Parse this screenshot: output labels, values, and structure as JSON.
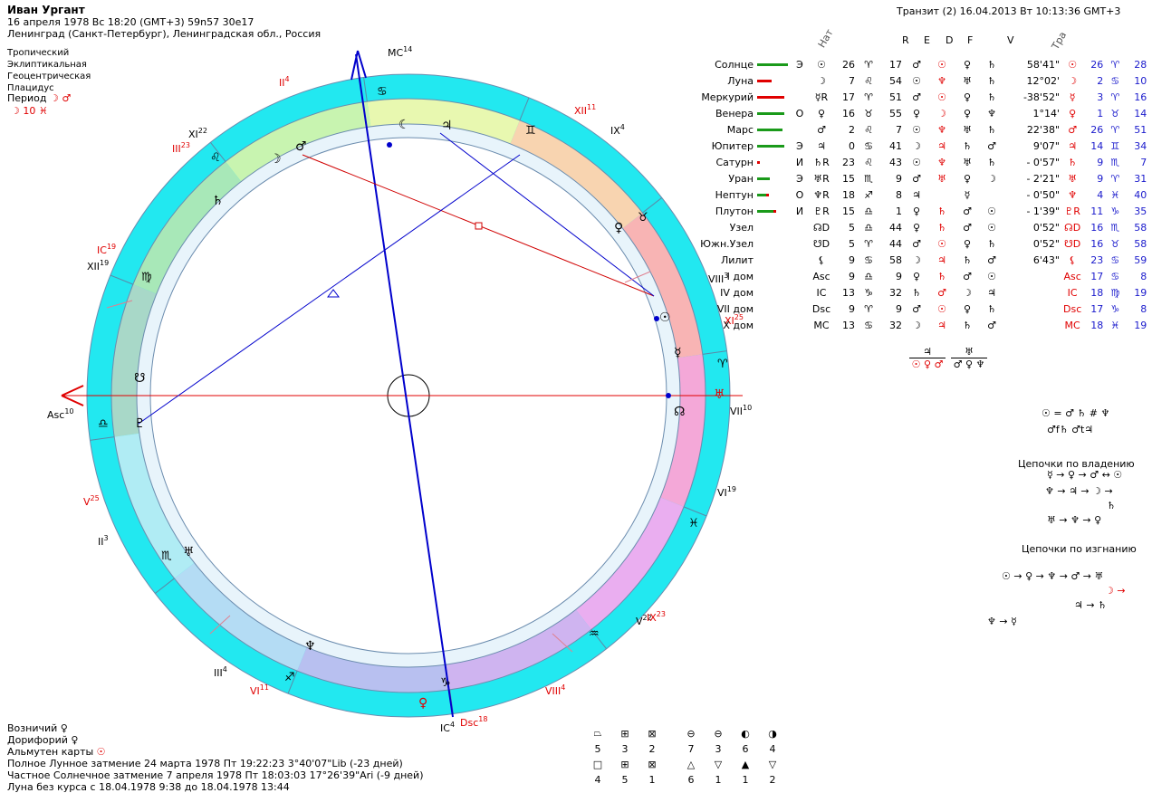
{
  "header": {
    "name": "Иван Ургант",
    "line1": "16 апреля 1978  Вс  18:20 (GMT+3) 59n57  30e17",
    "line2": "Ленинград (Санкт-Петербург), Ленинградская обл., Россия",
    "opts": [
      "Тропический",
      "Эклиптикальная",
      "Геоцентрическая",
      "Плацидус"
    ],
    "period_label": "Период",
    "period_syms": "☽ ♂",
    "period2": "☽   10 ♓"
  },
  "transit": "Транзит (2) 16.04.2013  Вт 10:13:36 GMT+3",
  "col_headers": {
    "nat": "Нат",
    "r": "R",
    "e": "E",
    "d": "D",
    "f": "F",
    "v": "V",
    "tra": "Тра"
  },
  "planets": [
    {
      "name": "Солнце",
      "cls": "Э",
      "sym": "☉",
      "deg": "26",
      "sign": "♈",
      "min": "17",
      "r": "♂",
      "e": "☉",
      "d": "♀",
      "f": "♄",
      "v": "58'41\"",
      "tsym": "☉",
      "tdeg": "26",
      "tsign": "♈",
      "tmin": "28",
      "bg": 34,
      "br": 0
    },
    {
      "name": "Луна",
      "cls": "",
      "sym": "☽",
      "deg": "7",
      "sign": "♌",
      "min": "54",
      "r": "☉",
      "e": "♆",
      "d": "♅",
      "f": "♄",
      "v": "12°02'",
      "tsym": "☽",
      "tdeg": "2",
      "tsign": "♋",
      "tmin": "10",
      "bg": 0,
      "br": 16
    },
    {
      "name": "Меркурий",
      "cls": "",
      "sym": "☿R",
      "deg": "17",
      "sign": "♈",
      "min": "51",
      "r": "♂",
      "e": "☉",
      "d": "♀",
      "f": "♄",
      "v": "-38'52\"",
      "tsym": "☿",
      "tdeg": "3",
      "tsign": "♈",
      "tmin": "16",
      "bg": 0,
      "br": 30
    },
    {
      "name": "Венера",
      "cls": "О",
      "sym": "♀",
      "deg": "16",
      "sign": "♉",
      "min": "55",
      "r": "♀",
      "e": "☽",
      "d": "♀",
      "f": "♆",
      "v": "1°14'",
      "tsym": "♀",
      "tdeg": "1",
      "tsign": "♉",
      "tmin": "14",
      "bg": 30,
      "br": 0
    },
    {
      "name": "Марс",
      "cls": "",
      "sym": "♂",
      "deg": "2",
      "sign": "♌",
      "min": "7",
      "r": "☉",
      "e": "♆",
      "d": "♅",
      "f": "♄",
      "v": "22'38\"",
      "tsym": "♂",
      "tdeg": "26",
      "tsign": "♈",
      "tmin": "51",
      "bg": 28,
      "br": 0
    },
    {
      "name": "Юпитер",
      "cls": "Э",
      "sym": "♃",
      "deg": "0",
      "sign": "♋",
      "min": "41",
      "r": "☽",
      "e": "♃",
      "d": "♄",
      "f": "♂",
      "v": "9'07\"",
      "tsym": "♃",
      "tdeg": "14",
      "tsign": "♊",
      "tmin": "34",
      "bg": 30,
      "br": 0
    },
    {
      "name": "Сатурн",
      "cls": "И",
      "sym": "♄R",
      "deg": "23",
      "sign": "♌",
      "min": "43",
      "r": "☉",
      "e": "♆",
      "d": "♅",
      "f": "♄",
      "v": "- 0'57\"",
      "tsym": "♄",
      "tdeg": "9",
      "tsign": "♏",
      "tmin": "7",
      "bg": 0,
      "br": 3
    },
    {
      "name": "Уран",
      "cls": "Э",
      "sym": "♅R",
      "deg": "15",
      "sign": "♏",
      "min": "9",
      "r": "♂",
      "e": "♅",
      "d": "♀",
      "f": "☽",
      "v": "- 2'21\"",
      "tsym": "♅",
      "tdeg": "9",
      "tsign": "♈",
      "tmin": "31",
      "bg": 14,
      "br": 0
    },
    {
      "name": "Нептун",
      "cls": "О",
      "sym": "♆R",
      "deg": "18",
      "sign": "♐",
      "min": "8",
      "r": "♃",
      "e": "",
      "d": "☿",
      "f": "",
      "v": "- 0'50\"",
      "tsym": "♆",
      "tdeg": "4",
      "tsign": "♓",
      "tmin": "40",
      "bg": 10,
      "br": 3
    },
    {
      "name": "Плутон",
      "cls": "И",
      "sym": "♇R",
      "deg": "15",
      "sign": "♎",
      "min": "1",
      "r": "♀",
      "e": "♄",
      "d": "♂",
      "f": "☉",
      "v": "- 1'39\"",
      "tsym": "♇R",
      "tdeg": "11",
      "tsign": "♑",
      "tmin": "35",
      "bg": 18,
      "br": 3
    },
    {
      "name": "Узел",
      "cls": "",
      "sym": "☊D",
      "deg": "5",
      "sign": "♎",
      "min": "44",
      "r": "♀",
      "e": "♄",
      "d": "♂",
      "f": "☉",
      "v": "0'52\"",
      "tsym": "☊D",
      "tdeg": "16",
      "tsign": "♏",
      "tmin": "58",
      "bg": 0,
      "br": 0
    },
    {
      "name": "Южн.Узел",
      "cls": "",
      "sym": "☋D",
      "deg": "5",
      "sign": "♈",
      "min": "44",
      "r": "♂",
      "e": "☉",
      "d": "♀",
      "f": "♄",
      "v": "0'52\"",
      "tsym": "☋D",
      "tdeg": "16",
      "tsign": "♉",
      "tmin": "58",
      "bg": 0,
      "br": 0
    },
    {
      "name": "Лилит",
      "cls": "",
      "sym": "⚸",
      "deg": "9",
      "sign": "♋",
      "min": "58",
      "r": "☽",
      "e": "♃",
      "d": "♄",
      "f": "♂",
      "v": "6'43\"",
      "tsym": "⚸",
      "tdeg": "23",
      "tsign": "♋",
      "tmin": "59",
      "bg": 0,
      "br": 0
    },
    {
      "name": "I дом",
      "cls": "",
      "sym": "Asc",
      "deg": "9",
      "sign": "♎",
      "min": "9",
      "r": "♀",
      "e": "♄",
      "d": "♂",
      "f": "☉",
      "v": "",
      "tsym": "Asc",
      "tdeg": "17",
      "tsign": "♋",
      "tmin": "8",
      "bg": 0,
      "br": 0
    },
    {
      "name": "IV дом",
      "cls": "",
      "sym": "IC",
      "deg": "13",
      "sign": "♑",
      "min": "32",
      "r": "♄",
      "e": "♂",
      "d": "☽",
      "f": "♃",
      "v": "",
      "tsym": "IC",
      "tdeg": "18",
      "tsign": "♍",
      "tmin": "19",
      "bg": 0,
      "br": 0
    },
    {
      "name": "VII дом",
      "cls": "",
      "sym": "Dsc",
      "deg": "9",
      "sign": "♈",
      "min": "9",
      "r": "♂",
      "e": "☉",
      "d": "♀",
      "f": "♄",
      "v": "",
      "tsym": "Dsc",
      "tdeg": "17",
      "tsign": "♑",
      "tmin": "8",
      "bg": 0,
      "br": 0
    },
    {
      "name": "X дом",
      "cls": "",
      "sym": "MC",
      "deg": "13",
      "sign": "♋",
      "min": "32",
      "r": "☽",
      "e": "♃",
      "d": "♄",
      "f": "♂",
      "v": "",
      "tsym": "MC",
      "tdeg": "18",
      "tsign": "♓",
      "tmin": "19",
      "bg": 0,
      "br": 0
    }
  ],
  "mid": {
    "j_top": "♃",
    "j_bot": "☉ ♀ ♂",
    "u_top": "♅",
    "u_bot": "♂ ♀ ♆"
  },
  "right": {
    "eq1": "☉ = ♂ ♄ # ♆",
    "eq2": "♂f♄ ♂t♃",
    "own_title": "Цепочки по владению",
    "own1": "☿ → ♀ → ♂ ↔ ☉",
    "own2": "♆ → ♃ → ☽ →",
    "own3": "♄",
    "own4": "♅ → ♆ → ♀",
    "exile_title": "Цепочки по изгнанию",
    "ex1": "☉ → ♀ → ♆ → ♂ → ♅",
    "ex2": "☽ →",
    "ex3": "♃ → ♄",
    "ex4": "♆ → ☿"
  },
  "bottom": {
    "voz_label": "Возничий",
    "voz_sym": "♀",
    "dor_label": "Дорифорий",
    "dor_sym": "♀",
    "alm_label": "Альмутен карты",
    "alm_sym": "☉",
    "ecl1": "Полное Лунное затмение 24 марта 1978 Пт 19:22:23  3°40'07\"Lib (-23 дней)",
    "ecl2": "Частное Солнечное затмение 7 апреля 1978 Пт 18:03:03 17°26'39\"Ari (-9 дней)",
    "luna": "Луна без курса с 18.04.1978  9:38 до 18.04.1978 13:44"
  },
  "grid": {
    "row1_syms": [
      "⏢",
      "⊞",
      "⊠",
      "⊖",
      "⊖",
      "◐",
      "◑"
    ],
    "row1_nums": [
      "5",
      "3",
      "2",
      "7",
      "3",
      "6",
      "4"
    ],
    "row2_syms": [
      "□",
      "⊞",
      "⊠",
      "△",
      "▽",
      "▲",
      "▽"
    ],
    "row2_nums": [
      "4",
      "5",
      "1",
      "6",
      "1",
      "1",
      "2"
    ]
  },
  "chart_labels": {
    "asc": "Asc",
    "asc_deg": "10",
    "mc": "MC",
    "mc_deg": "14",
    "ic": "IC",
    "ic_deg": "4",
    "dsc": "Dsc",
    "dsc_deg": "18",
    "houses": [
      {
        "t": "II",
        "d": "4",
        "c": "red"
      },
      {
        "t": "III",
        "d": "23",
        "c": "red"
      },
      {
        "t": "XI",
        "d": "22",
        "c": "blk"
      },
      {
        "t": "IC",
        "d": "19",
        "c": "red"
      },
      {
        "t": "XII",
        "d": "19",
        "c": "blk"
      },
      {
        "t": "V",
        "d": "25",
        "c": "red"
      },
      {
        "t": "II",
        "d": "3",
        "c": "blk"
      },
      {
        "t": "III",
        "d": "4",
        "c": "blk"
      },
      {
        "t": "VI",
        "d": "11",
        "c": "red"
      },
      {
        "t": "VIII",
        "d": "4",
        "c": "red"
      },
      {
        "t": "V",
        "d": "22",
        "c": "blk"
      },
      {
        "t": "IX",
        "d": "23",
        "c": "red"
      },
      {
        "t": "VI",
        "d": "19",
        "c": "blk"
      },
      {
        "t": "VII",
        "d": "10",
        "c": "blk"
      },
      {
        "t": "XI",
        "d": "25",
        "c": "red"
      },
      {
        "t": "VIII",
        "d": "3",
        "c": "blk"
      },
      {
        "t": "IX",
        "d": "4",
        "c": "blk"
      },
      {
        "t": "XII",
        "d": "11",
        "c": "red"
      }
    ]
  }
}
